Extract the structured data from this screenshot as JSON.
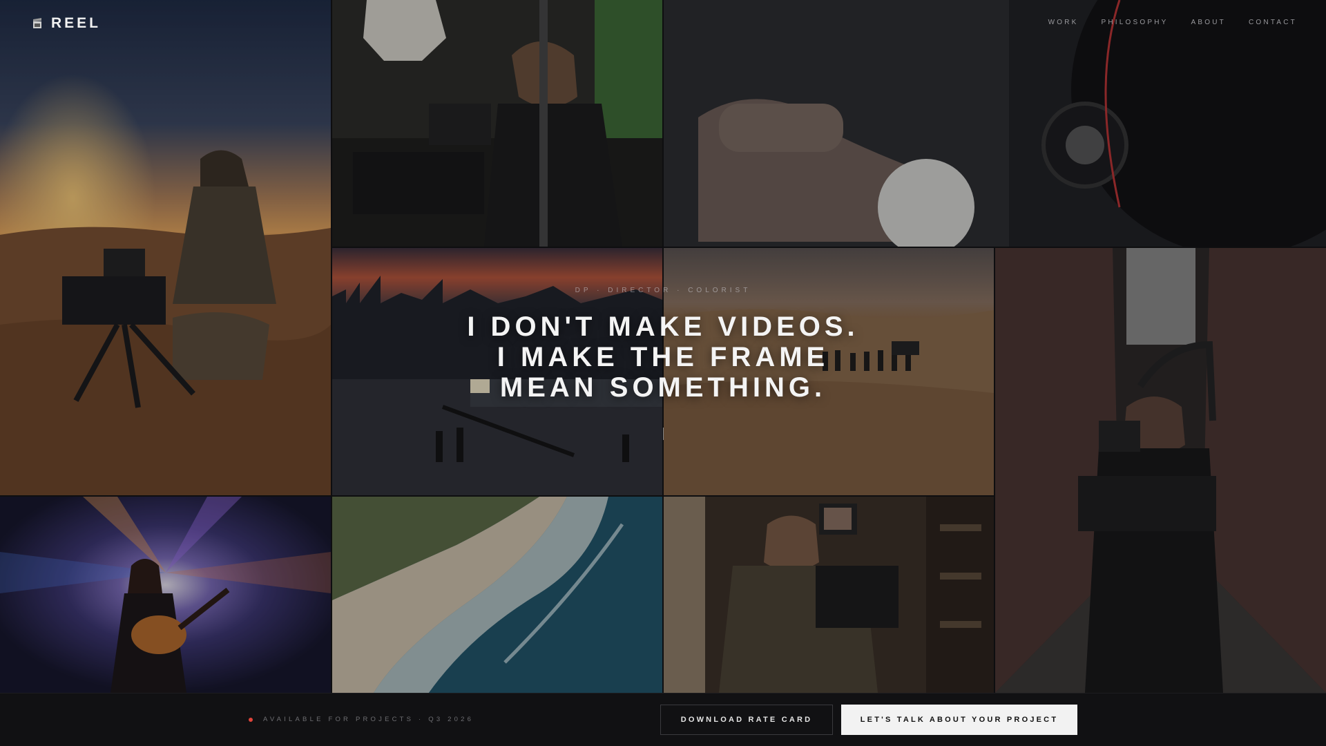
{
  "brand": {
    "name": "REEL",
    "logo_icon": "film-clapper-icon"
  },
  "nav": {
    "items": [
      "WORK",
      "PHILOSOPHY",
      "ABOUT",
      "CONTACT"
    ]
  },
  "hero": {
    "eyebrow": "DP · DIRECTOR · COLORIST",
    "headline_lines": [
      "I DON'T MAKE VIDEOS.",
      "I MAKE THE FRAME",
      "MEAN SOMETHING."
    ]
  },
  "tiles": [
    {
      "subject": "cameraman-in-desert-sunset"
    },
    {
      "subject": "operator-behind-cinema-camera-studio"
    },
    {
      "subject": "hand-on-lens-focus-ring"
    },
    {
      "subject": "rooftop-crane-shoot-city-dusk"
    },
    {
      "subject": "film-crew-on-sand-dunes"
    },
    {
      "subject": "steadicam-operator-in-alley"
    },
    {
      "subject": "guitarist-on-concert-stage"
    },
    {
      "subject": "aerial-beach-coastline"
    },
    {
      "subject": "handheld-camera-operator-indoors"
    }
  ],
  "footer": {
    "availability": "AVAILABLE FOR PROJECTS · Q3 2026",
    "status_color": "#e0443a",
    "download_label": "DOWNLOAD RATE CARD",
    "cta_label": "LET'S TALK ABOUT YOUR PROJECT"
  }
}
